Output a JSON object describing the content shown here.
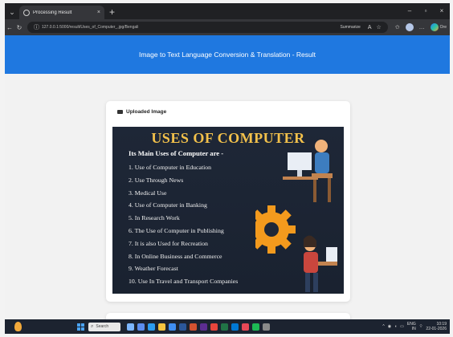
{
  "browser": {
    "tab_title": "Processing Result",
    "tab_close": "×",
    "new_tab": "+",
    "url": "127.0.0.1:5000/result/Uses_of_Computer_.jpg/Bengali",
    "summarize_label": "Summarize",
    "copilot_label": "Ore",
    "window_controls": [
      "–",
      "▫",
      "×"
    ]
  },
  "page": {
    "header_title": "Image to Text Language Conversion & Translation - Result",
    "uploaded_section_title": "Uploaded Image"
  },
  "uploaded_image": {
    "heading": "USES OF COMPUTER",
    "subheading": "Its Main Uses of Computer are -",
    "items": [
      "1. Use of Computer in Education",
      "2. Use Through News",
      "3. Medical Use",
      "4. Use of Computer in Banking",
      "5. In Research Work",
      "6. The Use of Computer in Publishing",
      "7. It is also Used for Recreation",
      "8. In Online Business and Commerce",
      "9. Weather Forecast",
      "10. Use In Travel and Transport Companies"
    ],
    "colors": {
      "heading": "#f3c14b",
      "background": "#1e2737",
      "gear": "#f39a1d"
    }
  },
  "taskbar": {
    "search_label": "Search",
    "lang": "ENG",
    "lang2": "IN",
    "time": "10:19",
    "date": "22-01-2026"
  },
  "colors": {
    "header_blue": "#1f78e0"
  }
}
